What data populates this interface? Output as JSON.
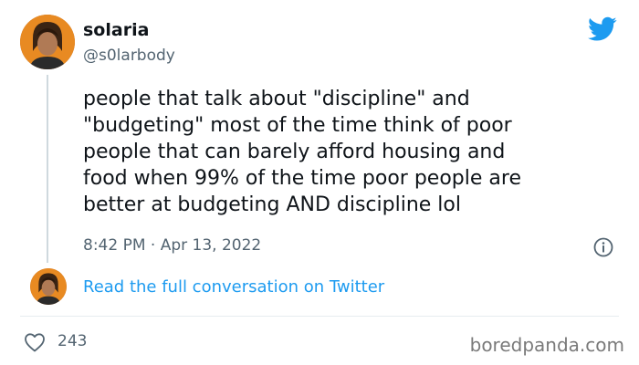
{
  "author": {
    "name": "solaria",
    "handle": "@s0larbody"
  },
  "tweet": {
    "text": "people that talk about \"discipline\" and\n\"budgeting\" most of the time think of poor\npeople that can barely afford housing and\nfood when 99% of the time poor people are\nbetter at budgeting AND discipline lol",
    "timestamp": "8:42 PM · Apr 13, 2022"
  },
  "conversation_link": "Read the full conversation on Twitter",
  "likes": "243",
  "watermark": "boredpanda.com",
  "colors": {
    "twitter_blue": "#1d9bf0",
    "secondary_text": "#536471",
    "primary_text": "#0f1419"
  },
  "icons": [
    "twitter-bird-icon",
    "info-icon",
    "heart-icon"
  ]
}
